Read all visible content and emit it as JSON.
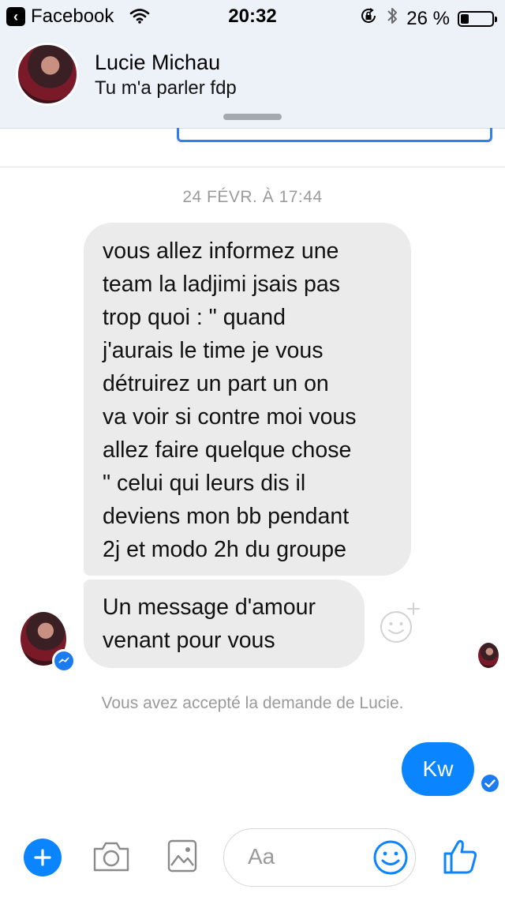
{
  "status_bar": {
    "back_app": "Facebook",
    "time": "20:32",
    "battery": "26 %",
    "battery_level_percent": 26
  },
  "header": {
    "contact_name": "Lucie Michau",
    "contact_status": "Tu m'a parler fdp"
  },
  "conversation": {
    "timestamp": "24 FÉVR. À 17:44",
    "incoming_messages": [
      {
        "lines": [
          "vous allez informez une",
          "team la ladjimi jsais pas",
          "trop quoi : \" quand",
          "j'aurais le time je vous",
          "détruirez un part un on",
          "va voir si contre moi vous",
          "allez faire quelque chose",
          "\" celui qui leurs dis il",
          "deviens mon bb pendant",
          "2j et modo 2h du groupe"
        ]
      },
      {
        "lines": [
          "Un message d'amour",
          "venant pour vous"
        ]
      }
    ],
    "system_note": "Vous avez accepté la demande de Lucie.",
    "outgoing_message": "Kw"
  },
  "composer": {
    "placeholder": "Aa"
  },
  "colors": {
    "accent": "#0a84ff",
    "header_bg": "#edf2f9",
    "incoming_bubble": "#ebebeb",
    "muted_text": "#9a9a9a"
  },
  "icons": [
    "back-chevron-icon",
    "wifi-icon",
    "lock-rotation-icon",
    "bluetooth-icon",
    "battery-icon",
    "messenger-badge-icon",
    "add-reaction-icon",
    "delivered-check-icon",
    "plus-icon",
    "camera-icon",
    "gallery-icon",
    "emoji-icon",
    "thumbs-up-icon"
  ]
}
